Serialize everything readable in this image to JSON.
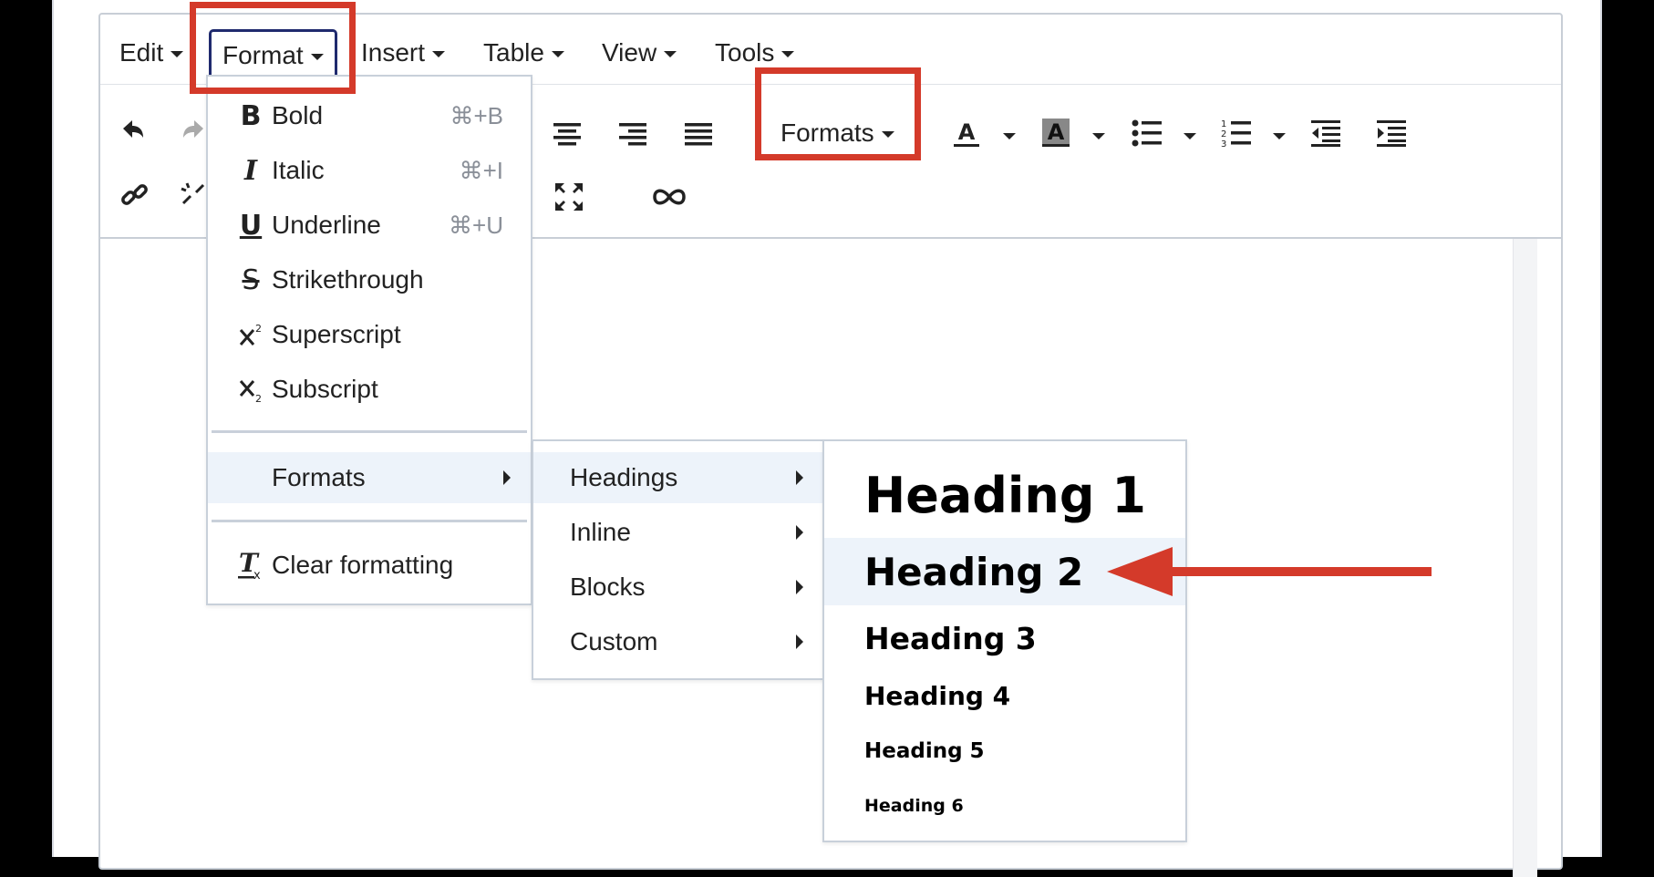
{
  "menubar": {
    "items": [
      "Edit",
      "Format",
      "Insert",
      "Table",
      "View",
      "Tools"
    ]
  },
  "toolbar": {
    "formats_label": "Formats"
  },
  "format_menu": {
    "bold": {
      "icon": "B",
      "label": "Bold",
      "shortcut": "⌘+B"
    },
    "italic": {
      "icon": "I",
      "label": "Italic",
      "shortcut": "⌘+I"
    },
    "underline": {
      "icon": "U",
      "label": "Underline",
      "shortcut": "⌘+U"
    },
    "strikethrough": {
      "icon": "S",
      "label": "Strikethrough"
    },
    "superscript": {
      "label": "Superscript"
    },
    "subscript": {
      "label": "Subscript"
    },
    "formats": {
      "label": "Formats"
    },
    "clear": {
      "label": "Clear formatting"
    }
  },
  "formats_menu": {
    "items": [
      "Headings",
      "Inline",
      "Blocks",
      "Custom"
    ]
  },
  "headings_menu": {
    "items": [
      "Heading 1",
      "Heading 2",
      "Heading 3",
      "Heading 4",
      "Heading 5",
      "Heading 6"
    ]
  },
  "colors": {
    "highlight": "#d43a2a",
    "active_menu_border": "#1f2a6e",
    "hover_bg": "#edf3fa"
  }
}
